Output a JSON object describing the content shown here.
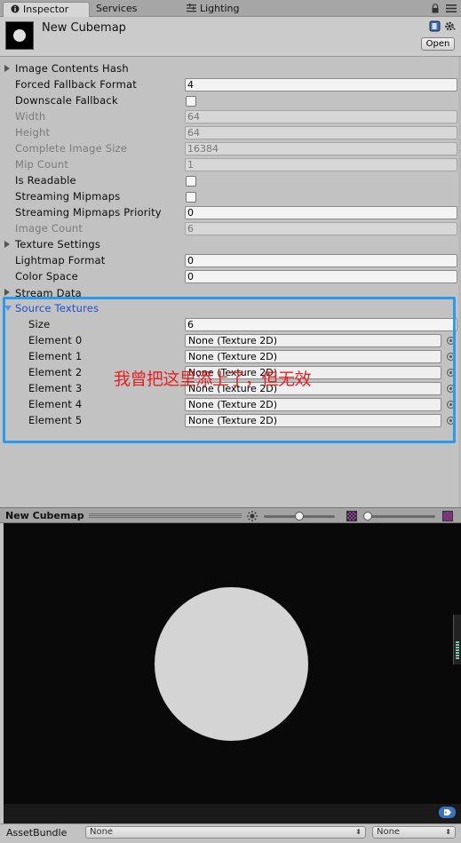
{
  "tabs": [
    {
      "label": "Inspector",
      "icon": "info-icon",
      "active": true
    },
    {
      "label": "Services",
      "icon": "",
      "active": false
    },
    {
      "label": "Lighting",
      "icon": "lighting-icon",
      "active": false
    }
  ],
  "asset": {
    "name": "New Cubemap",
    "open_label": "Open"
  },
  "properties": {
    "image_contents_hash": "Image Contents Hash",
    "forced_fallback_format": {
      "label": "Forced Fallback Format",
      "value": "4"
    },
    "downscale_fallback": {
      "label": "Downscale Fallback",
      "checked": false
    },
    "width": {
      "label": "Width",
      "value": "64"
    },
    "height": {
      "label": "Height",
      "value": "64"
    },
    "complete_image_size": {
      "label": "Complete Image Size",
      "value": "16384"
    },
    "mip_count": {
      "label": "Mip Count",
      "value": "1"
    },
    "is_readable": {
      "label": "Is Readable",
      "checked": false
    },
    "streaming_mipmaps": {
      "label": "Streaming Mipmaps",
      "checked": false
    },
    "streaming_mipmaps_priority": {
      "label": "Streaming Mipmaps Priority",
      "value": "0"
    },
    "image_count": {
      "label": "Image Count",
      "value": "6"
    },
    "texture_settings": "Texture Settings",
    "lightmap_format": {
      "label": "Lightmap Format",
      "value": "0"
    },
    "color_space": {
      "label": "Color Space",
      "value": "0"
    },
    "stream_data": "Stream Data"
  },
  "source_textures": {
    "title": "Source Textures",
    "size_label": "Size",
    "size_value": "6",
    "elements": [
      {
        "label": "Element 0",
        "value": "None (Texture 2D)"
      },
      {
        "label": "Element 1",
        "value": "None (Texture 2D)"
      },
      {
        "label": "Element 2",
        "value": "None (Texture 2D)"
      },
      {
        "label": "Element 3",
        "value": "None (Texture 2D)"
      },
      {
        "label": "Element 4",
        "value": "None (Texture 2D)"
      },
      {
        "label": "Element 5",
        "value": "None (Texture 2D)"
      }
    ]
  },
  "annotation": "我曾把这里添上了，但无效",
  "highlight_color": "#2a9af0",
  "preview": {
    "title": "New Cubemap",
    "background": "#090909",
    "sphere_color": "#d4d4d4"
  },
  "asset_bundle": {
    "label": "AssetBundle",
    "name_value": "None",
    "variant_value": "None"
  }
}
